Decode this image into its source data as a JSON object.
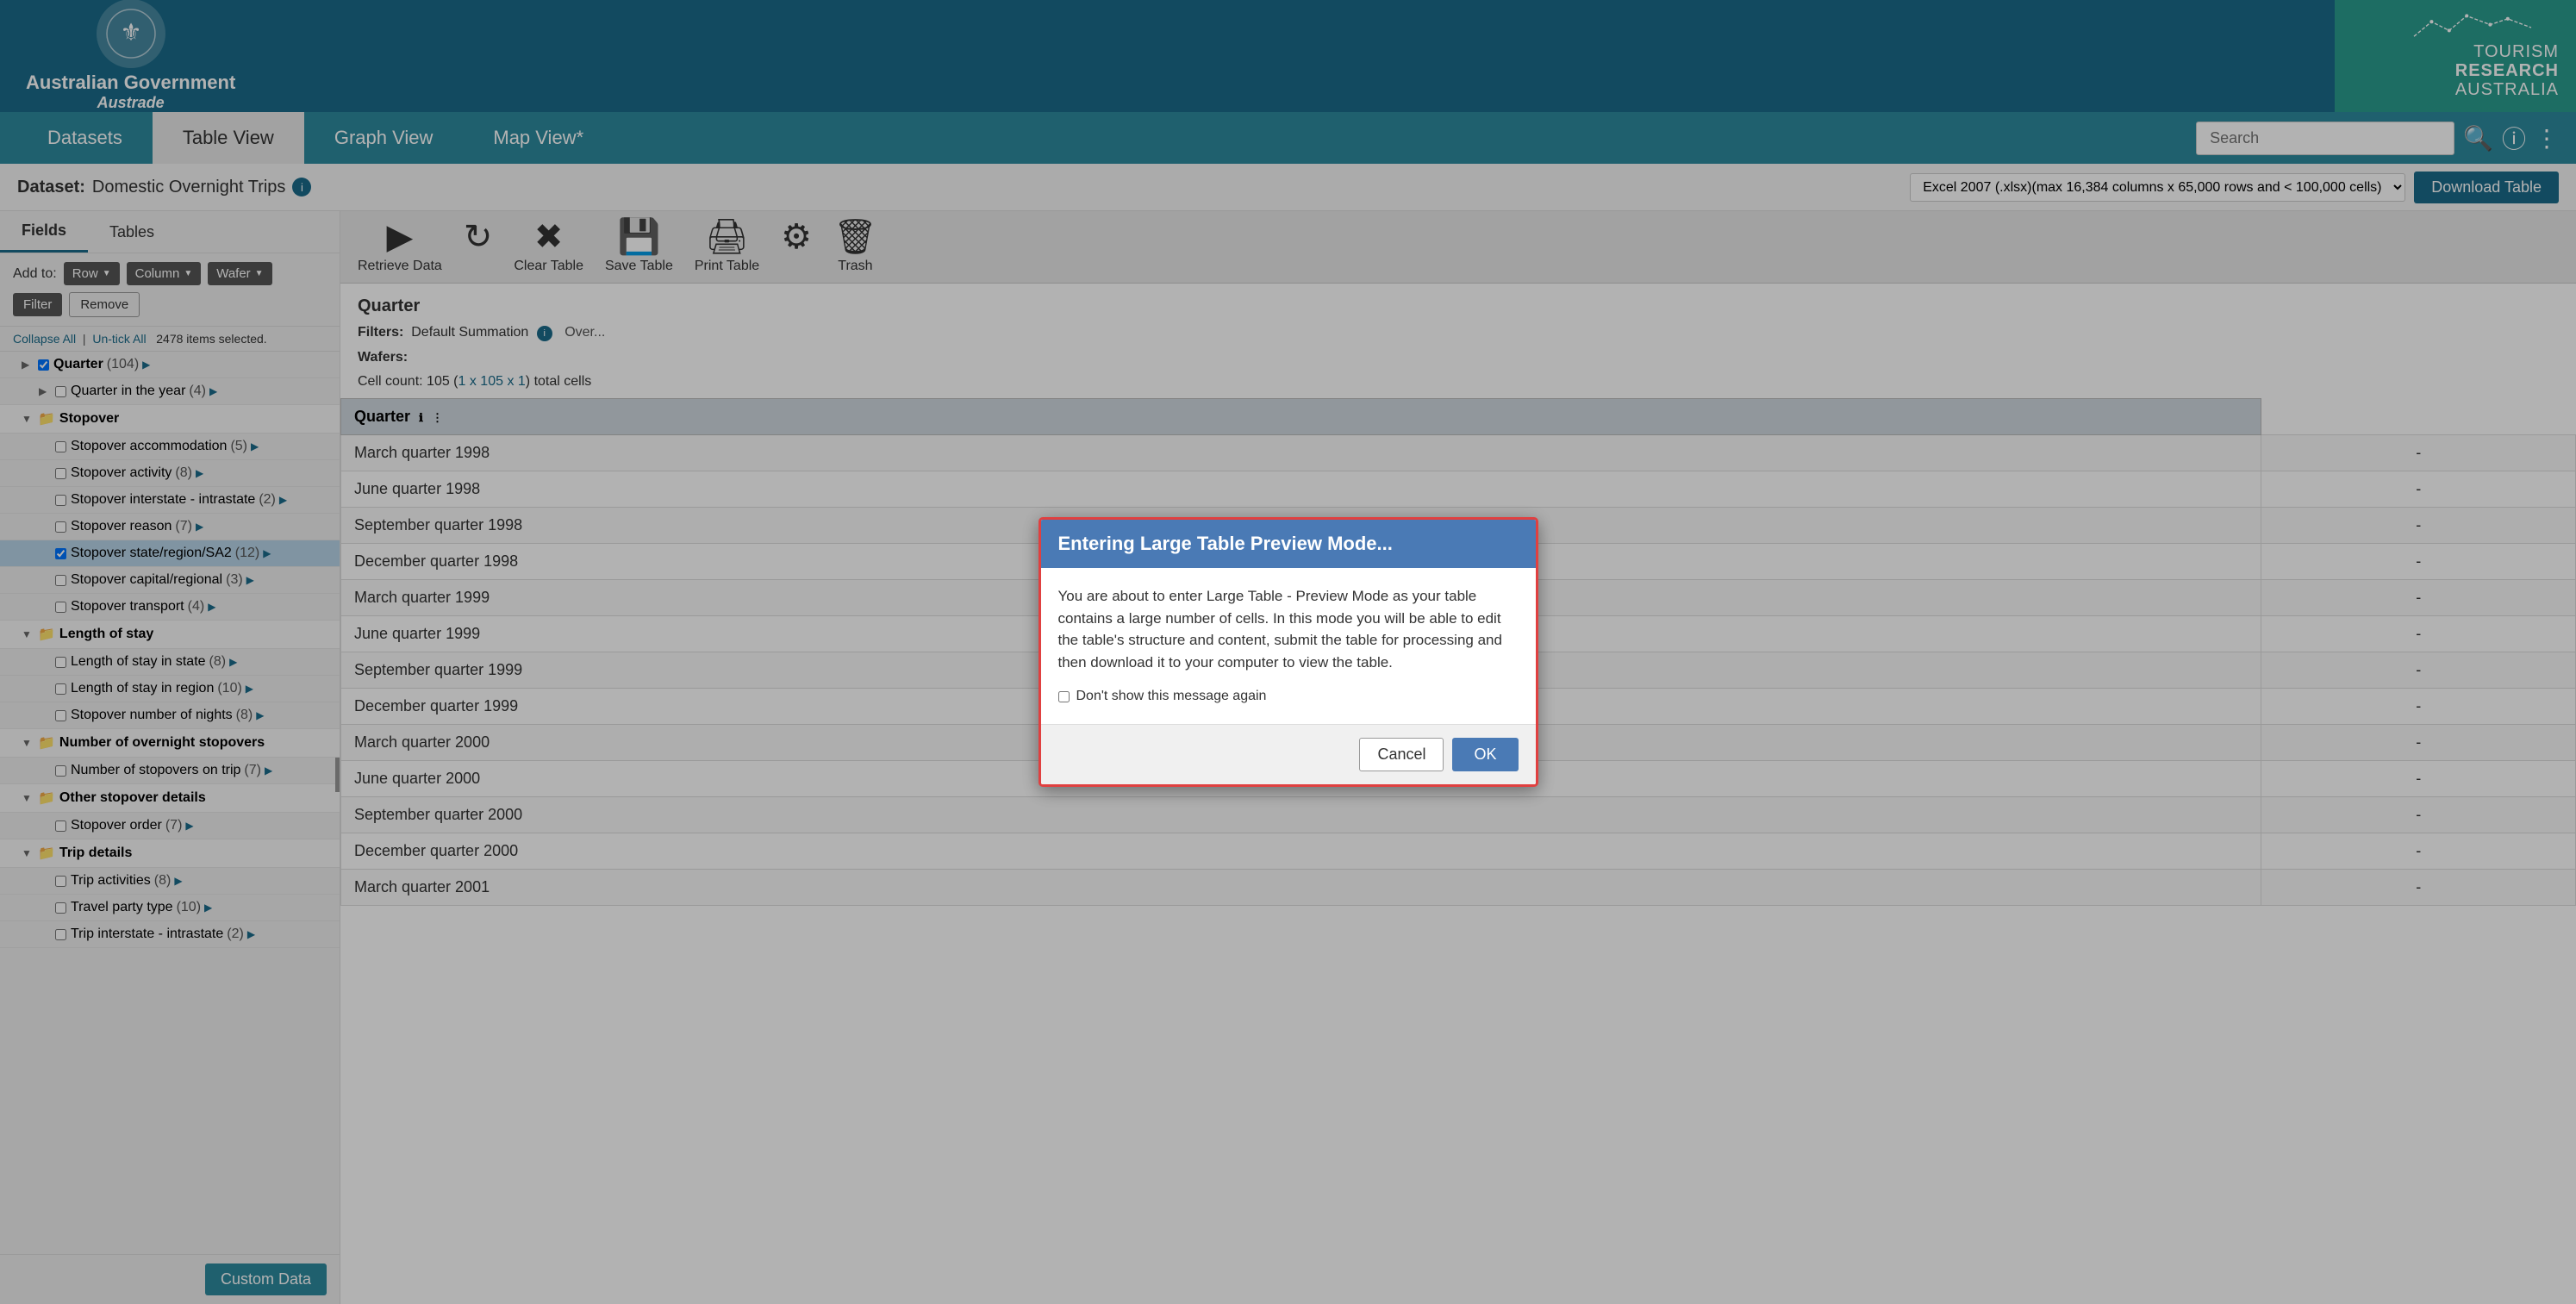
{
  "header": {
    "gov_line1": "Australian Government",
    "gov_line2": "Austrade",
    "tourism_title": "TOURISM\nRESEARCH\nAUSTRALIA"
  },
  "navbar": {
    "tabs": [
      "Datasets",
      "Table View",
      "Graph View",
      "Map View*"
    ],
    "active_tab": "Table View",
    "search_placeholder": "Search",
    "search_label": "Search"
  },
  "dataset_bar": {
    "label": "Dataset:",
    "name": "Domestic Overnight Trips",
    "format_options": [
      "Excel 2007 (.xlsx)(max 16,384 columns x 65,000 rows and < 100,000 cells)"
    ],
    "format_selected": "Excel 2007 (.xlsx)(max 16,384 columns x 65,000 rows and < 100,000 cells)",
    "download_btn": "Download Table"
  },
  "sidebar": {
    "tab_fields": "Fields",
    "tab_tables": "Tables",
    "add_label": "Add to:",
    "btn_row": "Row",
    "btn_column": "Column",
    "btn_wafer": "Wafer",
    "btn_filter": "Filter",
    "btn_remove": "Remove",
    "collapse_all": "Collapse All",
    "un_tick_all": "Un-tick All",
    "items_selected": "2478 items selected.",
    "tree": [
      {
        "level": 1,
        "type": "item",
        "label": "Quarter",
        "count": "(104)",
        "expanded": true,
        "bold": true
      },
      {
        "level": 2,
        "type": "item",
        "label": "Quarter in the year",
        "count": "(4)"
      },
      {
        "level": 1,
        "type": "folder",
        "label": "Stopover",
        "expanded": true
      },
      {
        "level": 2,
        "type": "item",
        "label": "Stopover accommodation",
        "count": "(5)"
      },
      {
        "level": 2,
        "type": "item",
        "label": "Stopover activity",
        "count": "(8)"
      },
      {
        "level": 2,
        "type": "item",
        "label": "Stopover interstate - intrastate",
        "count": "(2)"
      },
      {
        "level": 2,
        "type": "item",
        "label": "Stopover reason",
        "count": "(7)"
      },
      {
        "level": 2,
        "type": "item",
        "label": "Stopover state/region/SA2",
        "count": "(12)",
        "highlighted": true
      },
      {
        "level": 2,
        "type": "item",
        "label": "Stopover capital/regional",
        "count": "(3)"
      },
      {
        "level": 2,
        "type": "item",
        "label": "Stopover transport",
        "count": "(4)"
      },
      {
        "level": 1,
        "type": "folder",
        "label": "Length of stay",
        "expanded": true
      },
      {
        "level": 2,
        "type": "item",
        "label": "Length of stay in state",
        "count": "(8)"
      },
      {
        "level": 2,
        "type": "item",
        "label": "Length of stay in region",
        "count": "(10)"
      },
      {
        "level": 2,
        "type": "item",
        "label": "Stopover number of nights",
        "count": "(8)"
      },
      {
        "level": 1,
        "type": "folder",
        "label": "Number of overnight stopovers",
        "expanded": true
      },
      {
        "level": 2,
        "type": "item",
        "label": "Number of stopovers on trip",
        "count": "(7)"
      },
      {
        "level": 1,
        "type": "folder",
        "label": "Other stopover details",
        "expanded": true
      },
      {
        "level": 2,
        "type": "item",
        "label": "Stopover order",
        "count": "(7)"
      },
      {
        "level": 1,
        "type": "folder",
        "label": "Trip details",
        "expanded": true
      },
      {
        "level": 2,
        "type": "item",
        "label": "Trip activities",
        "count": "(8)"
      },
      {
        "level": 2,
        "type": "item",
        "label": "Travel party type",
        "count": "(10)"
      },
      {
        "level": 2,
        "type": "item",
        "label": "Trip interstate - intrastate",
        "count": "(2)"
      }
    ],
    "custom_data_btn": "Custom Data"
  },
  "toolbar": {
    "retrieve_label": "Retrieve Data",
    "clear_label": "Clear Table",
    "save_label": "Save Table",
    "print_label": "Print Table",
    "settings_label": "",
    "trash_label": "Trash"
  },
  "table_section": {
    "heading": "Quarter",
    "filters_label": "Filters:",
    "filters_value": "Default Summation",
    "wafers_label": "Wafers:",
    "cell_count_label": "Cell count: 105",
    "cell_count_link": "1 x 105 x 1",
    "cell_count_suffix": "total cells",
    "column_header": "Quarter",
    "rows": [
      "March quarter 1998",
      "June quarter 1998",
      "September quarter 1998",
      "December quarter 1998",
      "March quarter 1999",
      "June quarter 1999",
      "September quarter 1999",
      "December quarter 1999",
      "March quarter 2000",
      "June quarter 2000",
      "September quarter 2000",
      "December quarter 2000",
      "March quarter 2001"
    ]
  },
  "modal": {
    "title": "Entering Large Table Preview Mode...",
    "body": "You are about to enter Large Table - Preview Mode as your table contains a large number of cells. In this mode you will be able to edit the table's structure and content, submit the table for processing and then download it to your computer to view the table.",
    "checkbox_label": "Don't show this message again",
    "cancel_btn": "Cancel",
    "ok_btn": "OK"
  },
  "colors": {
    "header_bg": "#1a6b8a",
    "nav_bg": "#2d8a9e",
    "tourism_bg": "#2a9d8f",
    "modal_header_bg": "#4a7ab5",
    "modal_border": "#e04040",
    "sidebar_highlight": "#b8d4e8",
    "download_btn_bg": "#1a6b8a"
  }
}
